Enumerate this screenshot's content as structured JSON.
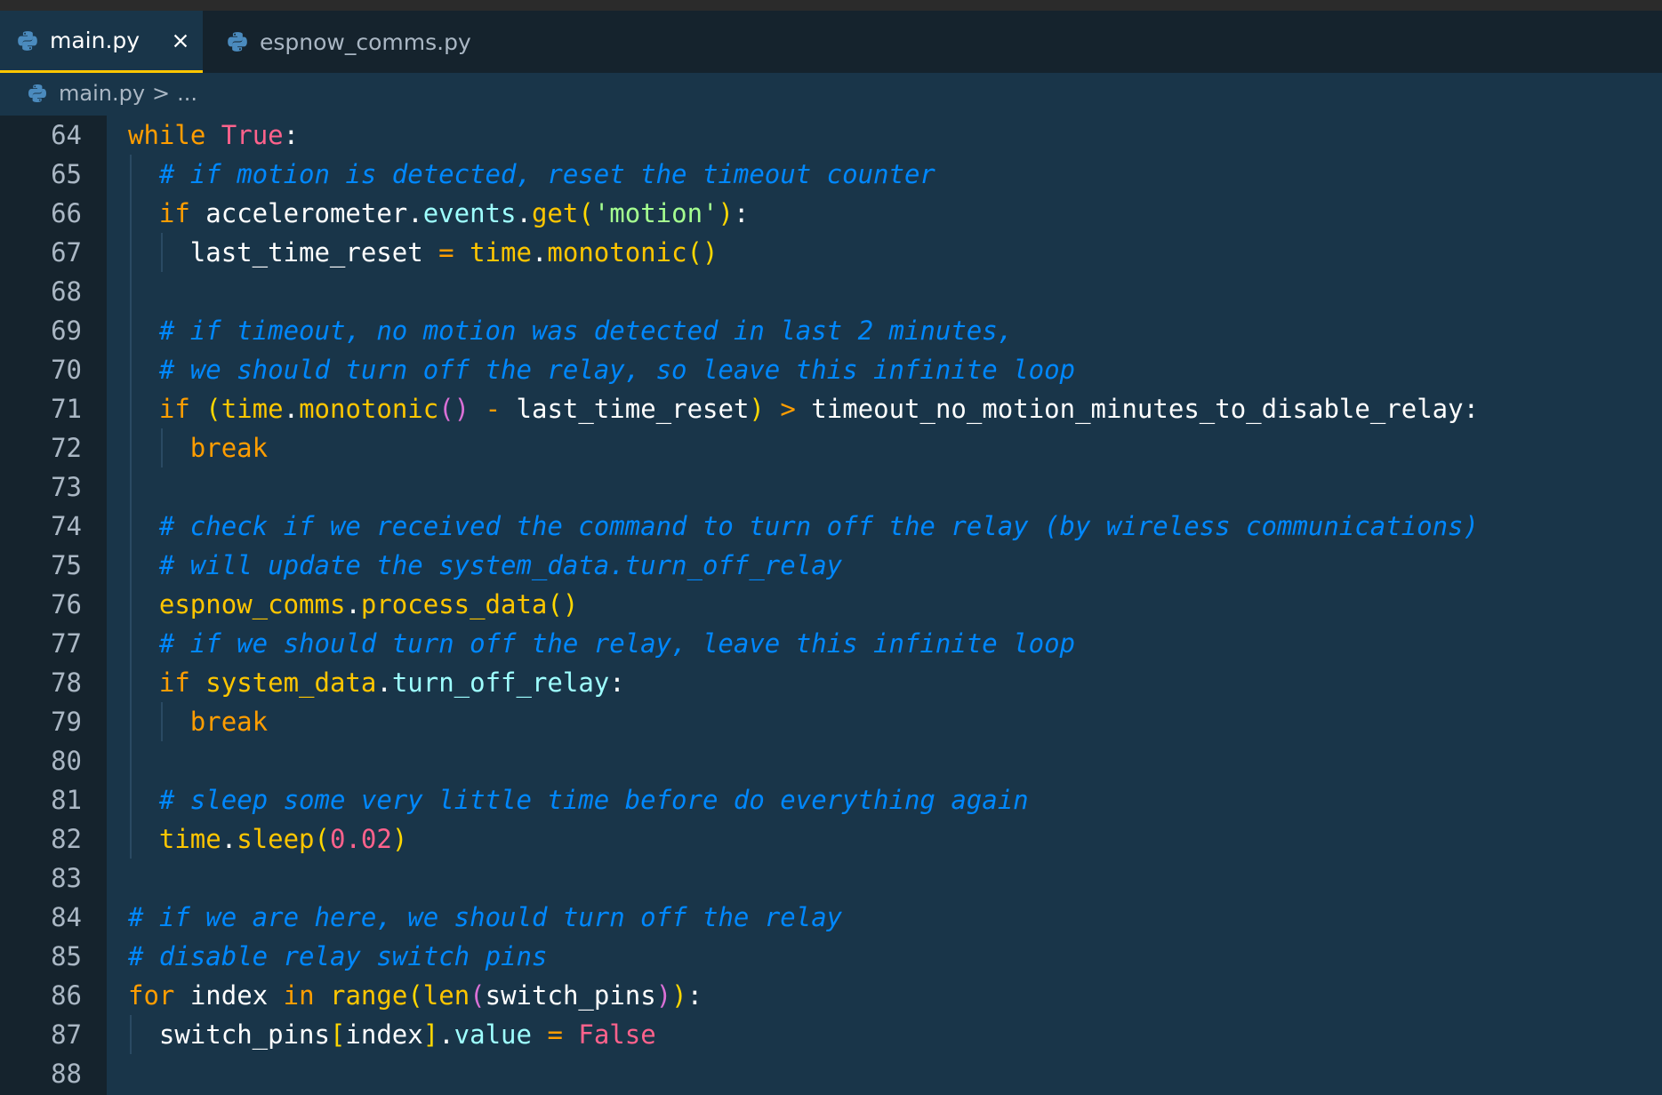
{
  "tabs": [
    {
      "label": "main.py",
      "active": true
    },
    {
      "label": "espnow_comms.py",
      "active": false
    }
  ],
  "breadcrumb": {
    "file": "main.py",
    "separator": ">",
    "more": "..."
  },
  "editor": {
    "lines": [
      {
        "num": "64",
        "indent": 0,
        "tokens": [
          [
            "kw",
            "while"
          ],
          [
            "",
            " "
          ],
          [
            "const",
            "True"
          ],
          [
            "punc",
            ":"
          ]
        ]
      },
      {
        "num": "65",
        "indent": 1,
        "tokens": [
          [
            "cm",
            "# if motion is detected, reset the timeout counter"
          ]
        ]
      },
      {
        "num": "66",
        "indent": 1,
        "tokens": [
          [
            "kw",
            "if"
          ],
          [
            "",
            " accelerometer"
          ],
          [
            "punc",
            "."
          ],
          [
            "prop",
            "events"
          ],
          [
            "punc",
            "."
          ],
          [
            "fn",
            "get"
          ],
          [
            "br1",
            "("
          ],
          [
            "str",
            "'motion'"
          ],
          [
            "br1",
            ")"
          ],
          [
            "punc",
            ":"
          ]
        ]
      },
      {
        "num": "67",
        "indent": 2,
        "tokens": [
          [
            "",
            "last_time_reset "
          ],
          [
            "op",
            "="
          ],
          [
            "",
            " "
          ],
          [
            "fn",
            "time"
          ],
          [
            "punc",
            "."
          ],
          [
            "fn",
            "monotonic"
          ],
          [
            "br1",
            "()"
          ]
        ]
      },
      {
        "num": "68",
        "indent": 1,
        "tokens": []
      },
      {
        "num": "69",
        "indent": 1,
        "tokens": [
          [
            "cm",
            "# if timeout, no motion was detected in last 2 minutes,"
          ]
        ]
      },
      {
        "num": "70",
        "indent": 1,
        "tokens": [
          [
            "cm",
            "# we should turn off the relay, so leave this infinite loop"
          ]
        ]
      },
      {
        "num": "71",
        "indent": 1,
        "tokens": [
          [
            "kw",
            "if"
          ],
          [
            "",
            " "
          ],
          [
            "br1",
            "("
          ],
          [
            "fn",
            "time"
          ],
          [
            "punc",
            "."
          ],
          [
            "fn",
            "monotonic"
          ],
          [
            "br2",
            "()"
          ],
          [
            "",
            " "
          ],
          [
            "op",
            "-"
          ],
          [
            "",
            " last_time_reset"
          ],
          [
            "br1",
            ")"
          ],
          [
            "",
            " "
          ],
          [
            "op",
            ">"
          ],
          [
            "",
            " timeout_no_motion_minutes_to_disable_relay"
          ],
          [
            "punc",
            ":"
          ]
        ]
      },
      {
        "num": "72",
        "indent": 2,
        "tokens": [
          [
            "kw",
            "break"
          ]
        ]
      },
      {
        "num": "73",
        "indent": 1,
        "tokens": []
      },
      {
        "num": "74",
        "indent": 1,
        "tokens": [
          [
            "cm",
            "# check if we received the command to turn off the relay (by wireless communications)"
          ]
        ]
      },
      {
        "num": "75",
        "indent": 1,
        "tokens": [
          [
            "cm",
            "# will update the system_data.turn_off_relay"
          ]
        ]
      },
      {
        "num": "76",
        "indent": 1,
        "tokens": [
          [
            "fn",
            "espnow_comms"
          ],
          [
            "punc",
            "."
          ],
          [
            "fn",
            "process_data"
          ],
          [
            "br1",
            "()"
          ]
        ]
      },
      {
        "num": "77",
        "indent": 1,
        "tokens": [
          [
            "cm",
            "# if we should turn off the relay, leave this infinite loop"
          ]
        ]
      },
      {
        "num": "78",
        "indent": 1,
        "tokens": [
          [
            "kw",
            "if"
          ],
          [
            "",
            " "
          ],
          [
            "fn",
            "system_data"
          ],
          [
            "punc",
            "."
          ],
          [
            "prop",
            "turn_off_relay"
          ],
          [
            "punc",
            ":"
          ]
        ]
      },
      {
        "num": "79",
        "indent": 2,
        "tokens": [
          [
            "kw",
            "break"
          ]
        ]
      },
      {
        "num": "80",
        "indent": 1,
        "tokens": []
      },
      {
        "num": "81",
        "indent": 1,
        "tokens": [
          [
            "cm",
            "# sleep some very little time before do everything again"
          ]
        ]
      },
      {
        "num": "82",
        "indent": 1,
        "tokens": [
          [
            "fn",
            "time"
          ],
          [
            "punc",
            "."
          ],
          [
            "fn",
            "sleep"
          ],
          [
            "br1",
            "("
          ],
          [
            "num",
            "0.02"
          ],
          [
            "br1",
            ")"
          ]
        ]
      },
      {
        "num": "83",
        "indent": 0,
        "tokens": []
      },
      {
        "num": "84",
        "indent": 0,
        "tokens": [
          [
            "cm",
            "# if we are here, we should turn off the relay"
          ]
        ]
      },
      {
        "num": "85",
        "indent": 0,
        "tokens": [
          [
            "cm",
            "# disable relay switch pins"
          ]
        ]
      },
      {
        "num": "86",
        "indent": 0,
        "tokens": [
          [
            "kw",
            "for"
          ],
          [
            "",
            " index "
          ],
          [
            "kw",
            "in"
          ],
          [
            "",
            " "
          ],
          [
            "fn",
            "range"
          ],
          [
            "br1",
            "("
          ],
          [
            "fn",
            "len"
          ],
          [
            "br2",
            "("
          ],
          [
            "",
            "switch_pins"
          ],
          [
            "br2",
            ")"
          ],
          [
            "br1",
            ")"
          ],
          [
            "punc",
            ":"
          ]
        ]
      },
      {
        "num": "87",
        "indent": 1,
        "tokens": [
          [
            "",
            "switch_pins"
          ],
          [
            "br1",
            "["
          ],
          [
            "",
            "index"
          ],
          [
            "br1",
            "]"
          ],
          [
            "punc",
            "."
          ],
          [
            "prop",
            "value"
          ],
          [
            "",
            " "
          ],
          [
            "op",
            "="
          ],
          [
            "",
            " "
          ],
          [
            "const",
            "False"
          ]
        ]
      },
      {
        "num": "88",
        "indent": 0,
        "tokens": []
      }
    ]
  },
  "colors": {
    "background": "#193549",
    "gutter": "#15232d",
    "keyword": "#ff9d00",
    "comment": "#0088ff",
    "function": "#ffc600",
    "string": "#a5ff90",
    "constant": "#ff628c",
    "property": "#9effff"
  }
}
